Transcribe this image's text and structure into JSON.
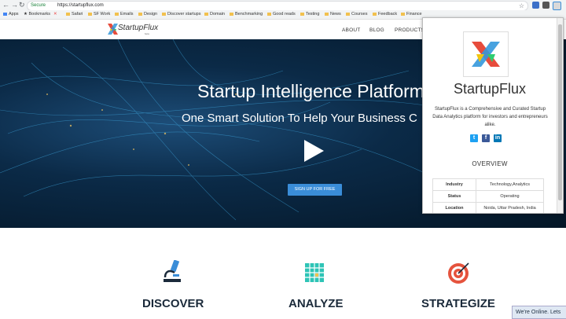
{
  "browser": {
    "secure_label": "Secure",
    "url": "https://startupflux.com",
    "bookmarks": [
      "Apps",
      "Bookmarks",
      "Safari",
      "SF Work",
      "Emails",
      "Design",
      "Discover startups",
      "Domain",
      "Benchmarking",
      "Good reads",
      "Testing",
      "News",
      "Courses",
      "Feedback",
      "Finance"
    ]
  },
  "site": {
    "logo_text": "StartupFlux",
    "logo_sub": "beta",
    "nav": [
      "ABOUT",
      "BLOG",
      "PRODUCTS"
    ]
  },
  "hero": {
    "title": "Startup Intelligence Platform",
    "subtitle": "One Smart Solution To Help Your Business C",
    "signup": "SIGN UP FOR FREE"
  },
  "features": [
    "DISCOVER",
    "ANALYZE",
    "STRATEGIZE"
  ],
  "popup": {
    "title": "StartupFlux",
    "description": "StartupFlux is a Comprehensive and Curated Startup Data Analytics platform for investors and entrepreneurs alike.",
    "overview_heading": "OVERVIEW",
    "overview": [
      {
        "key": "Industry",
        "value": "Technology,Analytics"
      },
      {
        "key": "Status",
        "value": "Operating"
      },
      {
        "key": "Location",
        "value": "Noida, Uttar Pradesh, India"
      }
    ]
  },
  "chat": "We're Online. Lets",
  "colors": {
    "accent": "#3a8dd8",
    "twitter": "#1da1f2",
    "facebook": "#3b5998",
    "linkedin": "#0077b5"
  }
}
